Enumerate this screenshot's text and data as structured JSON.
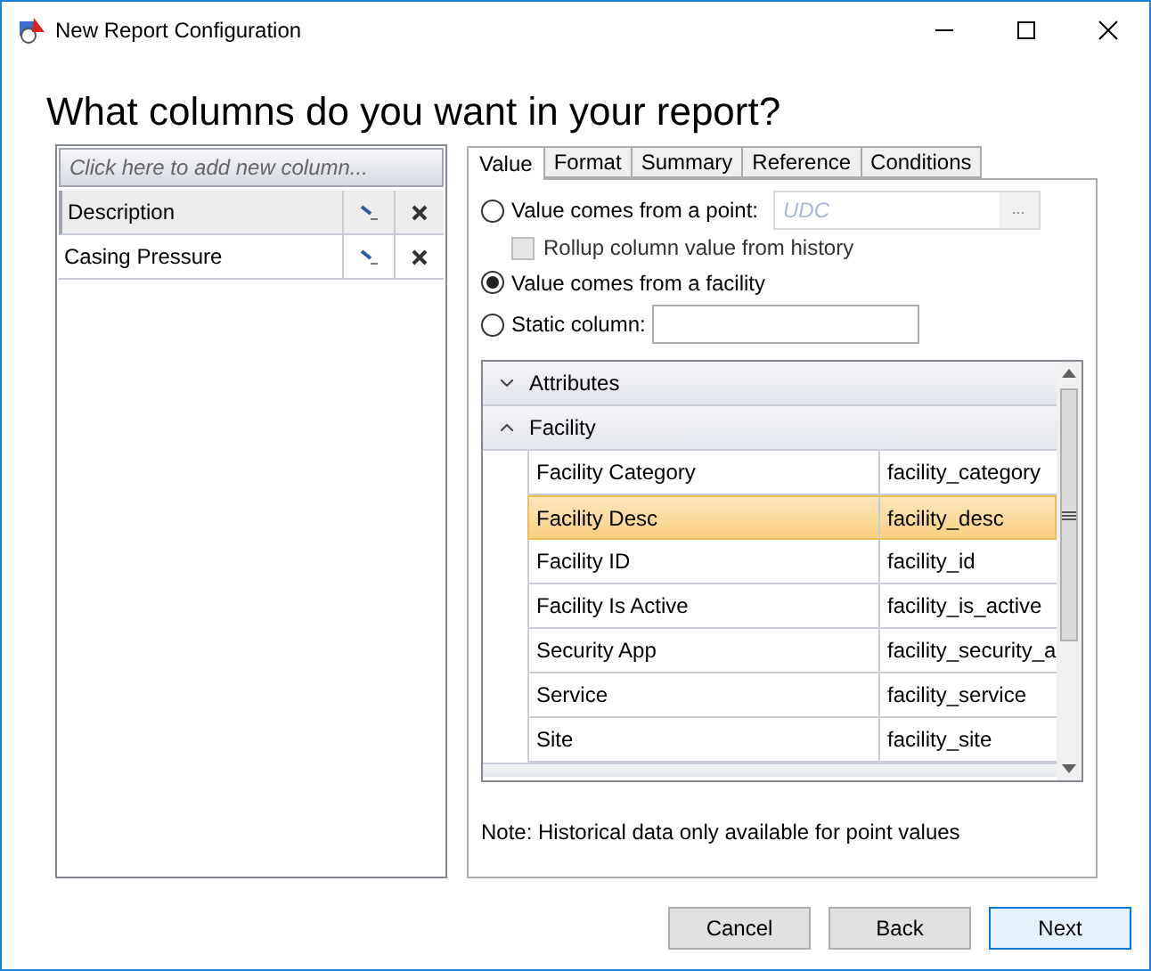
{
  "window": {
    "title": "New Report Configuration"
  },
  "heading": "What columns do you want in your report?",
  "columns_list": {
    "add_placeholder": "Click here to add new column...",
    "items": [
      {
        "name": "Description",
        "selected": true
      },
      {
        "name": "Casing Pressure",
        "selected": false
      }
    ]
  },
  "tabs": [
    {
      "label": "Value",
      "selected": true
    },
    {
      "label": "Format",
      "selected": false
    },
    {
      "label": "Summary",
      "selected": false
    },
    {
      "label": "Reference",
      "selected": false
    },
    {
      "label": "Conditions",
      "selected": false
    }
  ],
  "value_options": {
    "point": {
      "label": "Value comes from a point:",
      "selected": false,
      "placeholder": "UDC",
      "browse": "..."
    },
    "rollup": {
      "label": "Rollup column value from history",
      "checked": false,
      "disabled": true
    },
    "facility": {
      "label": "Value comes from a facility",
      "selected": true
    },
    "static": {
      "label": "Static column:",
      "selected": false
    }
  },
  "groups": [
    {
      "label": "Attributes",
      "expanded": false
    },
    {
      "label": "Facility",
      "expanded": true,
      "rows": [
        {
          "name": "Facility Category",
          "field": "facility_category",
          "selected": false
        },
        {
          "name": "Facility Desc",
          "field": "facility_desc",
          "selected": true
        },
        {
          "name": "Facility ID",
          "field": "facility_id",
          "selected": false
        },
        {
          "name": "Facility Is Active",
          "field": "facility_is_active",
          "selected": false
        },
        {
          "name": "Security App",
          "field": "facility_security_a",
          "selected": false
        },
        {
          "name": "Service",
          "field": "facility_service",
          "selected": false
        },
        {
          "name": "Site",
          "field": "facility_site",
          "selected": false
        }
      ]
    }
  ],
  "note": "Note: Historical data only available for point values",
  "buttons": [
    {
      "label": "Cancel",
      "kind": "normal"
    },
    {
      "label": "Back",
      "kind": "normal"
    },
    {
      "label": "Next",
      "kind": "default"
    }
  ]
}
